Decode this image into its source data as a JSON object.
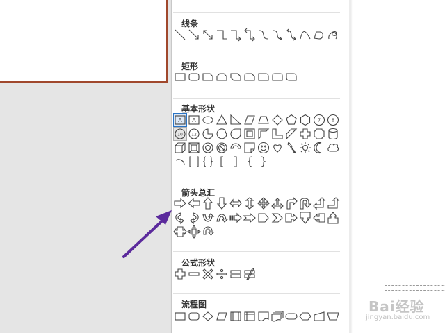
{
  "colors": {
    "slide_border": "#a0482c",
    "shape_stroke": "#444444",
    "arrow": "#5b2a9c",
    "selected_fill": "#dce8f7",
    "selected_stroke": "#2a74c5",
    "watermark": "#999999"
  },
  "panel": {
    "categories": [
      {
        "id": "lines",
        "title": "线条",
        "shapes": [
          "line",
          "arrow-line",
          "double-arrow-line",
          "elbow-connector",
          "elbow-arrow-connector",
          "elbow-double-arrow-connector",
          "curved-connector",
          "curved-arrow-connector",
          "curved-double-arrow-connector",
          "curve",
          "freeform",
          "scribble"
        ]
      },
      {
        "id": "rectangles",
        "title": "矩形",
        "shapes": [
          "rectangle",
          "rounded-rectangle",
          "snip-single-corner-rectangle",
          "snip-same-side-corner-rectangle",
          "snip-diagonal-corner-rectangle",
          "snip-round-single-corner-rectangle",
          "round-single-corner-rectangle",
          "round-same-side-corner-rectangle",
          "round-diagonal-corner-rectangle"
        ]
      },
      {
        "id": "basic",
        "title": "基本形状",
        "shapes": [
          "text-box",
          "vertical-text-box",
          "oval",
          "isosceles-triangle",
          "right-triangle",
          "parallelogram",
          "trapezoid",
          "diamond",
          "pentagon",
          "hexagon",
          "heptagon",
          "octagon",
          "decagon",
          "dodecagon",
          "pie",
          "chord",
          "teardrop",
          "frame",
          "half-frame",
          "l-shape",
          "diagonal-stripe",
          "cross",
          "plaque",
          "can",
          "cube",
          "bevel",
          "donut",
          "no-symbol",
          "block-arc",
          "folded-corner",
          "smiley-face",
          "heart",
          "lightning-bolt",
          "sun",
          "moon",
          "cloud",
          "arc",
          "double-bracket",
          "double-brace",
          "left-bracket",
          "right-bracket",
          "left-brace",
          "right-brace"
        ]
      },
      {
        "id": "block-arrows",
        "title": "箭头总汇",
        "shapes": [
          "right-arrow",
          "left-arrow",
          "up-arrow",
          "down-arrow",
          "left-right-arrow",
          "up-down-arrow",
          "quad-arrow",
          "left-right-up-arrow",
          "bent-arrow",
          "u-turn-arrow",
          "left-up-arrow",
          "bent-up-arrow",
          "curved-right-arrow",
          "curved-left-arrow",
          "curved-up-arrow",
          "curved-down-arrow",
          "striped-right-arrow",
          "notched-right-arrow",
          "pentagon-arrow",
          "chevron",
          "right-arrow-callout",
          "down-arrow-callout",
          "left-arrow-callout",
          "up-arrow-callout",
          "left-right-arrow-callout",
          "quad-arrow-callout",
          "circular-arrow"
        ]
      },
      {
        "id": "equation",
        "title": "公式形状",
        "shapes": [
          "plus",
          "minus",
          "multiply",
          "divide",
          "equal",
          "not-equal"
        ]
      },
      {
        "id": "flowchart",
        "title": "流程图",
        "shapes": [
          "process",
          "alternate-process",
          "decision",
          "data",
          "predefined-process",
          "internal-storage",
          "document",
          "multidocument",
          "terminator",
          "preparation",
          "manual-input",
          "manual-operation"
        ]
      }
    ],
    "top_partial_shapes": [
      "plaque-partial",
      "curved-partial",
      "partial-3",
      "partial-4"
    ],
    "selected_shape": "text-box",
    "hovered_shape": "decagon"
  },
  "watermark": {
    "brand": "Bai经验",
    "url": "jingyan.baidu.com"
  }
}
